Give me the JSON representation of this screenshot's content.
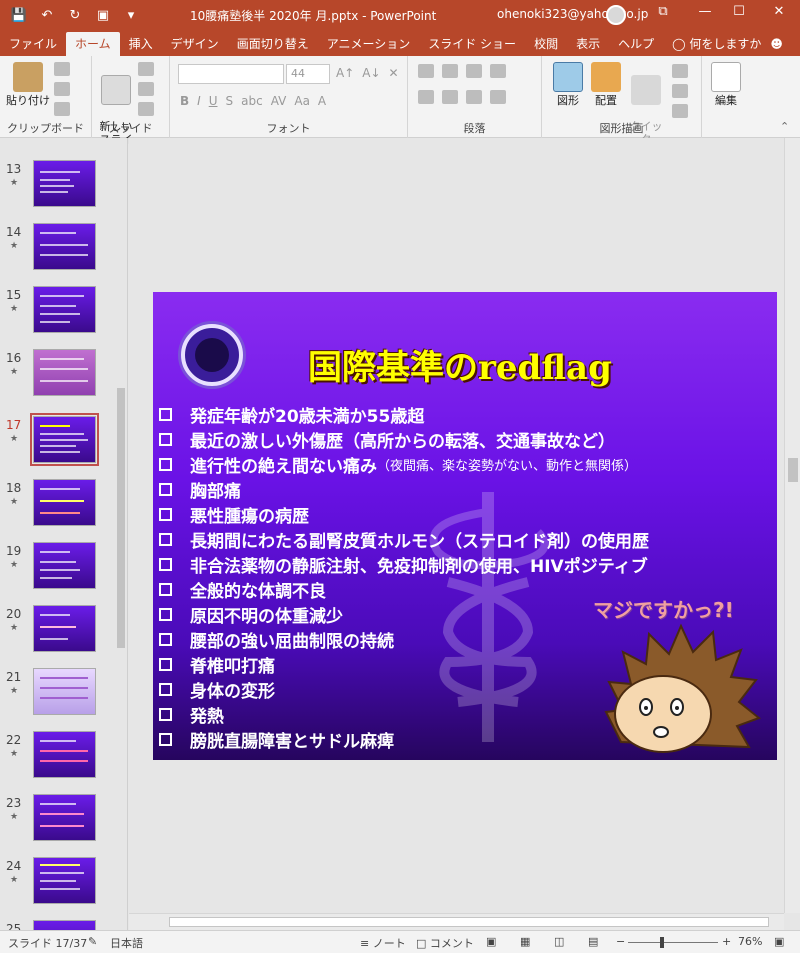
{
  "window": {
    "title": "10腰痛塾後半  2020年  月.pptx  -  PowerPoint",
    "account": "ohenoki323@yahoo.co.jp",
    "minimize": "—",
    "restore": "☐",
    "close": "✕",
    "ribbon_opts": "⧉"
  },
  "tabs": [
    "ファイル",
    "ホーム",
    "挿入",
    "デザイン",
    "画面切り替え",
    "アニメーション",
    "スライド ショー",
    "校閲",
    "表示",
    "ヘルプ"
  ],
  "tell_me": "何をしますか",
  "share": "共有",
  "ribbon": {
    "clipboard": {
      "paste": "貼り付け",
      "label": "クリップボード"
    },
    "slides": {
      "new_slide": "新しい\nスライド",
      "label": "スライド"
    },
    "font": {
      "size": "44",
      "label": "フォント",
      "bold": "B",
      "italic": "I",
      "underline": "U",
      "strike": "S",
      "shadow": "abc",
      "spacing": "AV",
      "case": "Aa",
      "color": "A"
    },
    "paragraph": {
      "label": "段落"
    },
    "drawing": {
      "shapes": "図形",
      "arrange": "配置",
      "quick_styles": "クイック\nスタイル",
      "label": "図形描画"
    },
    "editing": {
      "label": "編集"
    }
  },
  "thumbnails": [
    {
      "num": "13",
      "star": "★"
    },
    {
      "num": "14",
      "star": "★"
    },
    {
      "num": "15",
      "star": "★"
    },
    {
      "num": "16",
      "star": "★"
    },
    {
      "num": "17",
      "star": "★"
    },
    {
      "num": "18",
      "star": "★"
    },
    {
      "num": "19",
      "star": "★"
    },
    {
      "num": "20",
      "star": "★"
    },
    {
      "num": "21",
      "star": "★"
    },
    {
      "num": "22",
      "star": "★"
    },
    {
      "num": "23",
      "star": "★"
    },
    {
      "num": "24",
      "star": "★"
    },
    {
      "num": "25",
      "star": ""
    }
  ],
  "slide": {
    "title": "国際基準のredflag",
    "bullets": [
      {
        "main": "発症年齢が20歳未満か55歳超",
        "small": ""
      },
      {
        "main": "最近の激しい外傷歴（高所からの転落、交通事故など）",
        "small": ""
      },
      {
        "main": "進行性の絶え間ない痛み",
        "small": "（夜間痛、楽な姿勢がない、動作と無関係）"
      },
      {
        "main": "胸部痛",
        "small": ""
      },
      {
        "main": "悪性腫瘍の病歴",
        "small": ""
      },
      {
        "main": "長期間にわたる副腎皮質ホルモン（ステロイド剤）の使用歴",
        "small": ""
      },
      {
        "main": "非合法薬物の静脈注射、免疫抑制剤の使用、HIVポジティブ",
        "small": ""
      },
      {
        "main": "全般的な体調不良",
        "small": ""
      },
      {
        "main": "原因不明の体重減少",
        "small": ""
      },
      {
        "main": "腰部の強い屈曲制限の持続",
        "small": ""
      },
      {
        "main": "脊椎叩打痛",
        "small": ""
      },
      {
        "main": "身体の変形",
        "small": ""
      },
      {
        "main": "発熱",
        "small": ""
      },
      {
        "main": "膀胱直腸障害とサドル麻痺",
        "small": ""
      }
    ],
    "bubble": "マジですかっ?!"
  },
  "status": {
    "slide_indicator": "スライド 17/37",
    "language": "日本語",
    "notes": "ノート",
    "comments": "コメント",
    "zoom": "76%",
    "zoom_minus": "−",
    "zoom_plus": "+"
  }
}
